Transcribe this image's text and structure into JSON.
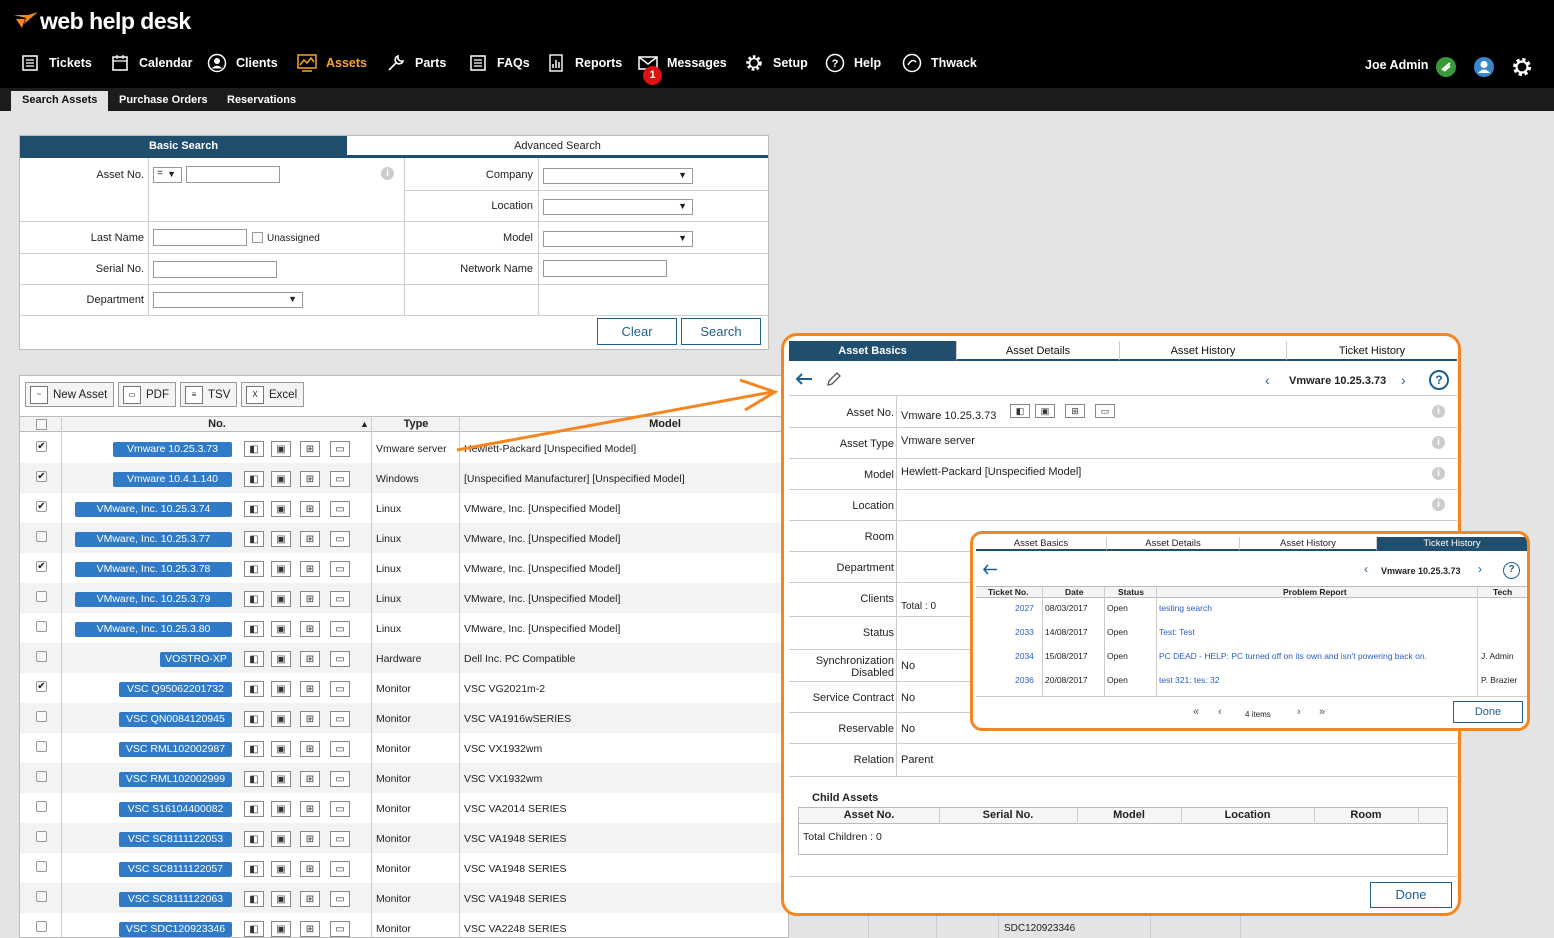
{
  "brand": {
    "logo": "web help desk",
    "accent": "#f5861f",
    "dark_blue": "#1f4e6e",
    "pill_blue": "#2f7bc7"
  },
  "nav": [
    {
      "label": "Tickets",
      "icon": "list-icon"
    },
    {
      "label": "Calendar",
      "icon": "calendar-icon"
    },
    {
      "label": "Clients",
      "icon": "user-circle-icon"
    },
    {
      "label": "Assets",
      "icon": "chart-icon",
      "active": true
    },
    {
      "label": "Parts",
      "icon": "wrench-icon"
    },
    {
      "label": "FAQs",
      "icon": "list-icon"
    },
    {
      "label": "Reports",
      "icon": "bar-report-icon"
    },
    {
      "label": "Messages",
      "icon": "envelope-icon",
      "badge": "1"
    },
    {
      "label": "Setup",
      "icon": "gear-icon"
    },
    {
      "label": "Help",
      "icon": "question-icon"
    },
    {
      "label": "Thwack",
      "icon": "chat-icon"
    }
  ],
  "user": {
    "name": "Joe Admin"
  },
  "subnav": [
    "Search Assets",
    "Purchase Orders",
    "Reservations"
  ],
  "search": {
    "tabs": [
      "Basic Search",
      "Advanced Search"
    ],
    "asset_no_label": "Asset No.",
    "asset_no_operator": "=",
    "last_name_label": "Last Name",
    "unassigned_label": "Unassigned",
    "serial_no_label": "Serial No.",
    "department_label": "Department",
    "company_label": "Company",
    "location_label": "Location",
    "model_label": "Model",
    "network_name_label": "Network Name",
    "clear": "Clear",
    "search": "Search"
  },
  "toolbar": {
    "new_asset": "New Asset",
    "pdf": "PDF",
    "tsv": "TSV",
    "excel": "Excel"
  },
  "table": {
    "headers": [
      "No.",
      "Type",
      "Model"
    ],
    "rows": [
      {
        "no": "Vmware 10.25.3.73",
        "type": "Vmware server",
        "model": "Hewlett-Packard [Unspecified Model]",
        "checked": true
      },
      {
        "no": "Vmware 10.4.1.140",
        "type": "Windows",
        "model": "[Unspecified Manufacturer] [Unspecified Model]",
        "checked": true
      },
      {
        "no": "VMware, Inc. 10.25.3.74",
        "type": "Linux",
        "model": "VMware, Inc. [Unspecified Model]",
        "checked": true
      },
      {
        "no": "VMware, Inc. 10.25.3.77",
        "type": "Linux",
        "model": "VMware, Inc. [Unspecified Model]",
        "checked": false
      },
      {
        "no": "VMware, Inc. 10.25.3.78",
        "type": "Linux",
        "model": "VMware, Inc. [Unspecified Model]",
        "checked": true
      },
      {
        "no": "VMware, Inc. 10.25.3.79",
        "type": "Linux",
        "model": "VMware, Inc. [Unspecified Model]",
        "checked": false
      },
      {
        "no": "VMware, Inc. 10.25.3.80",
        "type": "Linux",
        "model": "VMware, Inc. [Unspecified Model]",
        "checked": false
      },
      {
        "no": "VOSTRO-XP",
        "type": "Hardware",
        "model": "Dell Inc. PC Compatible",
        "checked": false
      },
      {
        "no": "VSC Q95062201732",
        "type": "Monitor",
        "model": "VSC VG2021m-2",
        "checked": true
      },
      {
        "no": "VSC QN0084120945",
        "type": "Monitor",
        "model": "VSC VA1916wSERIES",
        "checked": false
      },
      {
        "no": "VSC RML102002987",
        "type": "Monitor",
        "model": "VSC VX1932wm",
        "checked": false
      },
      {
        "no": "VSC RML102002999",
        "type": "Monitor",
        "model": "VSC VX1932wm",
        "checked": false
      },
      {
        "no": "VSC S16104400082",
        "type": "Monitor",
        "model": "VSC VA2014 SERIES",
        "checked": false
      },
      {
        "no": "VSC SC8111122053",
        "type": "Monitor",
        "model": "VSC VA1948 SERIES",
        "checked": false
      },
      {
        "no": "VSC SC8111122057",
        "type": "Monitor",
        "model": "VSC VA1948 SERIES",
        "checked": false
      },
      {
        "no": "VSC SC8111122063",
        "type": "Monitor",
        "model": "VSC VA1948 SERIES",
        "checked": false
      },
      {
        "no": "VSC SDC120923346",
        "type": "Monitor",
        "model": "VSC VA2248 SERIES",
        "checked": false
      }
    ],
    "behind_serial": "SDC120923346"
  },
  "basics": {
    "tabs": [
      "Asset Basics",
      "Asset Details",
      "Asset History",
      "Ticket History"
    ],
    "title": "Vmware 10.25.3.73",
    "fields": [
      {
        "label": "Asset No.",
        "value": "Vmware 10.25.3.73"
      },
      {
        "label": "Asset Type",
        "value": "Vmware server"
      },
      {
        "label": "Model",
        "value": "Hewlett-Packard [Unspecified Model]"
      },
      {
        "label": "Location",
        "value": ""
      },
      {
        "label": "Room",
        "value": ""
      },
      {
        "label": "Department",
        "value": ""
      },
      {
        "label": "Clients",
        "value": "Total : 0"
      },
      {
        "label": "Status",
        "value": ""
      },
      {
        "label": "Synchronization Disabled",
        "value": "No"
      },
      {
        "label": "Service Contract",
        "value": "No"
      },
      {
        "label": "Reservable",
        "value": "No"
      },
      {
        "label": "Relation",
        "value": "Parent"
      }
    ],
    "child_assets_title": "Child Assets",
    "child_headers": [
      "Asset No.",
      "Serial No.",
      "Model",
      "Location",
      "Room"
    ],
    "total_children": "Total Children : 0",
    "done": "Done"
  },
  "history": {
    "tabs": [
      "Asset Basics",
      "Asset Details",
      "Asset History",
      "Ticket History"
    ],
    "title": "Vmware 10.25.3.73",
    "headers": [
      "Ticket No.",
      "Date",
      "Status",
      "Problem Report",
      "Tech"
    ],
    "rows": [
      {
        "no": "2027",
        "date": "08/03/2017",
        "status": "Open",
        "report": "testing search",
        "tech": ""
      },
      {
        "no": "2033",
        "date": "14/08/2017",
        "status": "Open",
        "report": "Test: Test",
        "tech": ""
      },
      {
        "no": "2034",
        "date": "15/08/2017",
        "status": "Open",
        "report": "PC DEAD - HELP: PC turned off on its own and isn't powering back on.",
        "tech": "J. Admin"
      },
      {
        "no": "2036",
        "date": "20/08/2017",
        "status": "Open",
        "report": "test 321: tes: 32",
        "tech": "P. Brazier"
      }
    ],
    "pager": "4 items",
    "done": "Done"
  }
}
